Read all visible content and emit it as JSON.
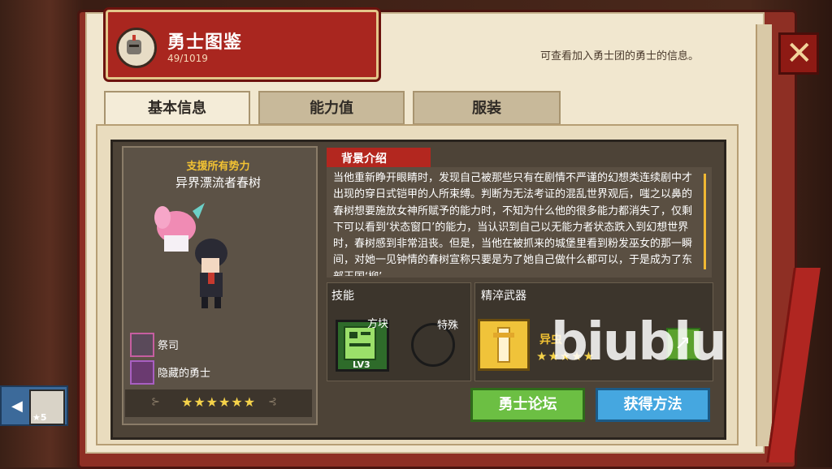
{
  "header": {
    "title": "勇士图鉴",
    "count": "49/1019",
    "description": "可查看加入勇士团的勇士的信息。"
  },
  "tabs": [
    {
      "label": "基本信息",
      "active": true
    },
    {
      "label": "能力值"
    },
    {
      "label": "服装"
    }
  ],
  "character": {
    "affiliation": "支援所有势力",
    "name": "异界漂流者春树",
    "class": "祭司",
    "hidden": "隐藏的勇士",
    "stars": "★★★★★★"
  },
  "story": {
    "title": "背景介绍",
    "text": "当他重新睁开眼睛时，发现自己被那些只有在剧情不严谨的幻想类连续剧中才出现的穿日式铠甲的人所束缚。判断为无法考证的混乱世界观后，嗤之以鼻的春树想要施放女神所赋予的能力时，不知为什么他的很多能力都消失了，仅剩下可以看到‘状态窗口’的能力，当认识到自己以无能力者状态跌入到幻想世界时，春树感到非常沮丧。但是，当他在被抓来的城堡里看到粉发巫女的那一瞬间，对她一见钟情的春树宣称只要是为了她自己做什么都可以，于是成为了东部王国‘柳’"
  },
  "skills": {
    "title": "技能",
    "block_label": "方块",
    "block_level": "LV3",
    "special_label": "特殊"
  },
  "weapon": {
    "title": "精淬武器",
    "name": "异虫",
    "stars": "★★★★★"
  },
  "buttons": {
    "forum": "勇士论坛",
    "obtain": "获得方法"
  },
  "nav": {
    "prev_badge": "★5"
  },
  "watermark": "biublu",
  "colors": {
    "header_red": "#a9261f",
    "gold": "#f2c233",
    "forum_green": "#6cbf43",
    "obtain_blue": "#45a7e0"
  }
}
